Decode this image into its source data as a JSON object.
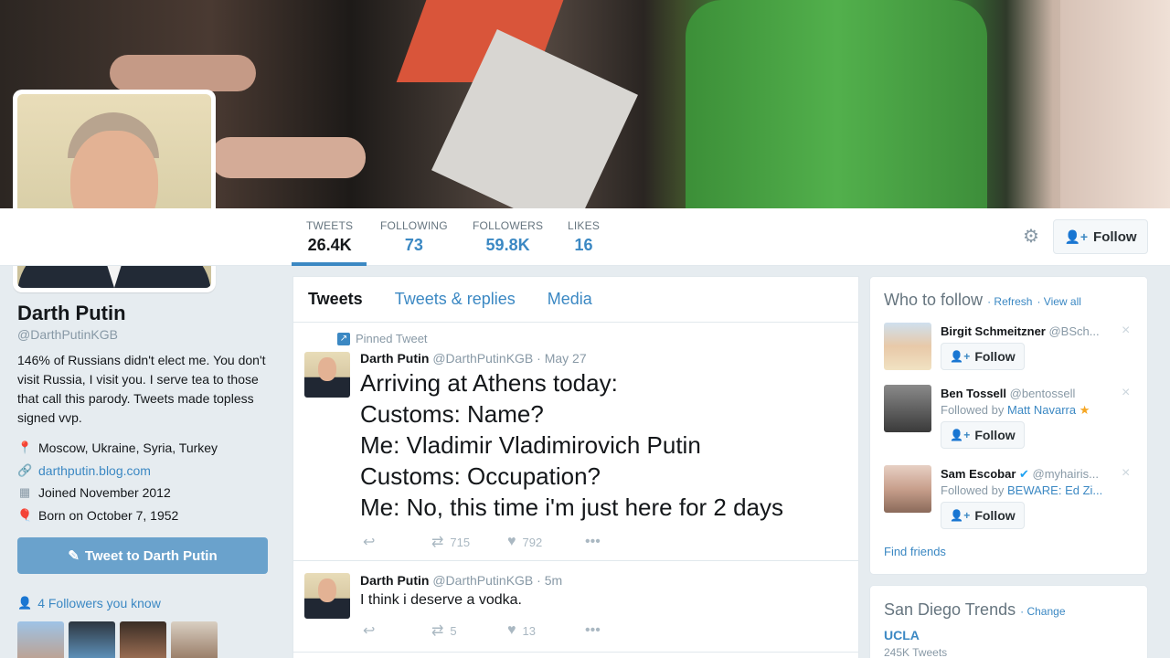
{
  "profile": {
    "name": "Darth Putin",
    "handle": "@DarthPutinKGB",
    "bio": "146% of Russians didn't elect me. You don't visit Russia, I visit you. I serve tea to those that call this parody. Tweets made topless signed vvp.",
    "location": "Moscow, Ukraine, Syria, Turkey",
    "website": "darthputin.blog.com",
    "joined": "Joined November 2012",
    "born": "Born on October 7, 1952",
    "tweet_to_label": "Tweet to Darth Putin",
    "followers_you_know": "4 Followers you know"
  },
  "stats": [
    {
      "label": "TWEETS",
      "value": "26.4K"
    },
    {
      "label": "FOLLOWING",
      "value": "73"
    },
    {
      "label": "FOLLOWERS",
      "value": "59.8K"
    },
    {
      "label": "LIKES",
      "value": "16"
    }
  ],
  "follow_label": "Follow",
  "tabs": [
    "Tweets",
    "Tweets & replies",
    "Media"
  ],
  "tweets": [
    {
      "pinned_label": "Pinned Tweet",
      "name": "Darth Putin",
      "handle": "@DarthPutinKGB",
      "time": "· May 27",
      "lines": [
        "Arriving at Athens today:",
        "Customs: Name?",
        "Me: Vladimir Vladimirovich Putin",
        "Customs: Occupation?",
        "Me: No, this time i'm just here for 2 days"
      ],
      "retweets": "715",
      "likes": "792"
    },
    {
      "name": "Darth Putin",
      "handle": "@DarthPutinKGB",
      "time": "· 5m",
      "text": "I think i deserve a vodka.",
      "retweets": "5",
      "likes": "13"
    }
  ],
  "who_to_follow": {
    "title": "Who to follow",
    "refresh": "Refresh",
    "view_all": "View all",
    "suggestions": [
      {
        "name": "Birgit Schmeitzner",
        "handle": "@BSch...",
        "followed_by": "",
        "followed_name": ""
      },
      {
        "name": "Ben Tossell",
        "handle": "@bentossell",
        "followed_by": "Followed by ",
        "followed_name": "Matt Navarra"
      },
      {
        "name": "Sam Escobar",
        "handle": "@myhairis...",
        "followed_by": "Followed by ",
        "followed_name": "BEWARE: Ed Zi..."
      }
    ],
    "follow_label": "Follow",
    "find_friends": "Find friends"
  },
  "trends": {
    "title": "San Diego Trends",
    "change": "Change",
    "items": [
      {
        "name": "UCLA",
        "count": "245K Tweets"
      }
    ]
  }
}
